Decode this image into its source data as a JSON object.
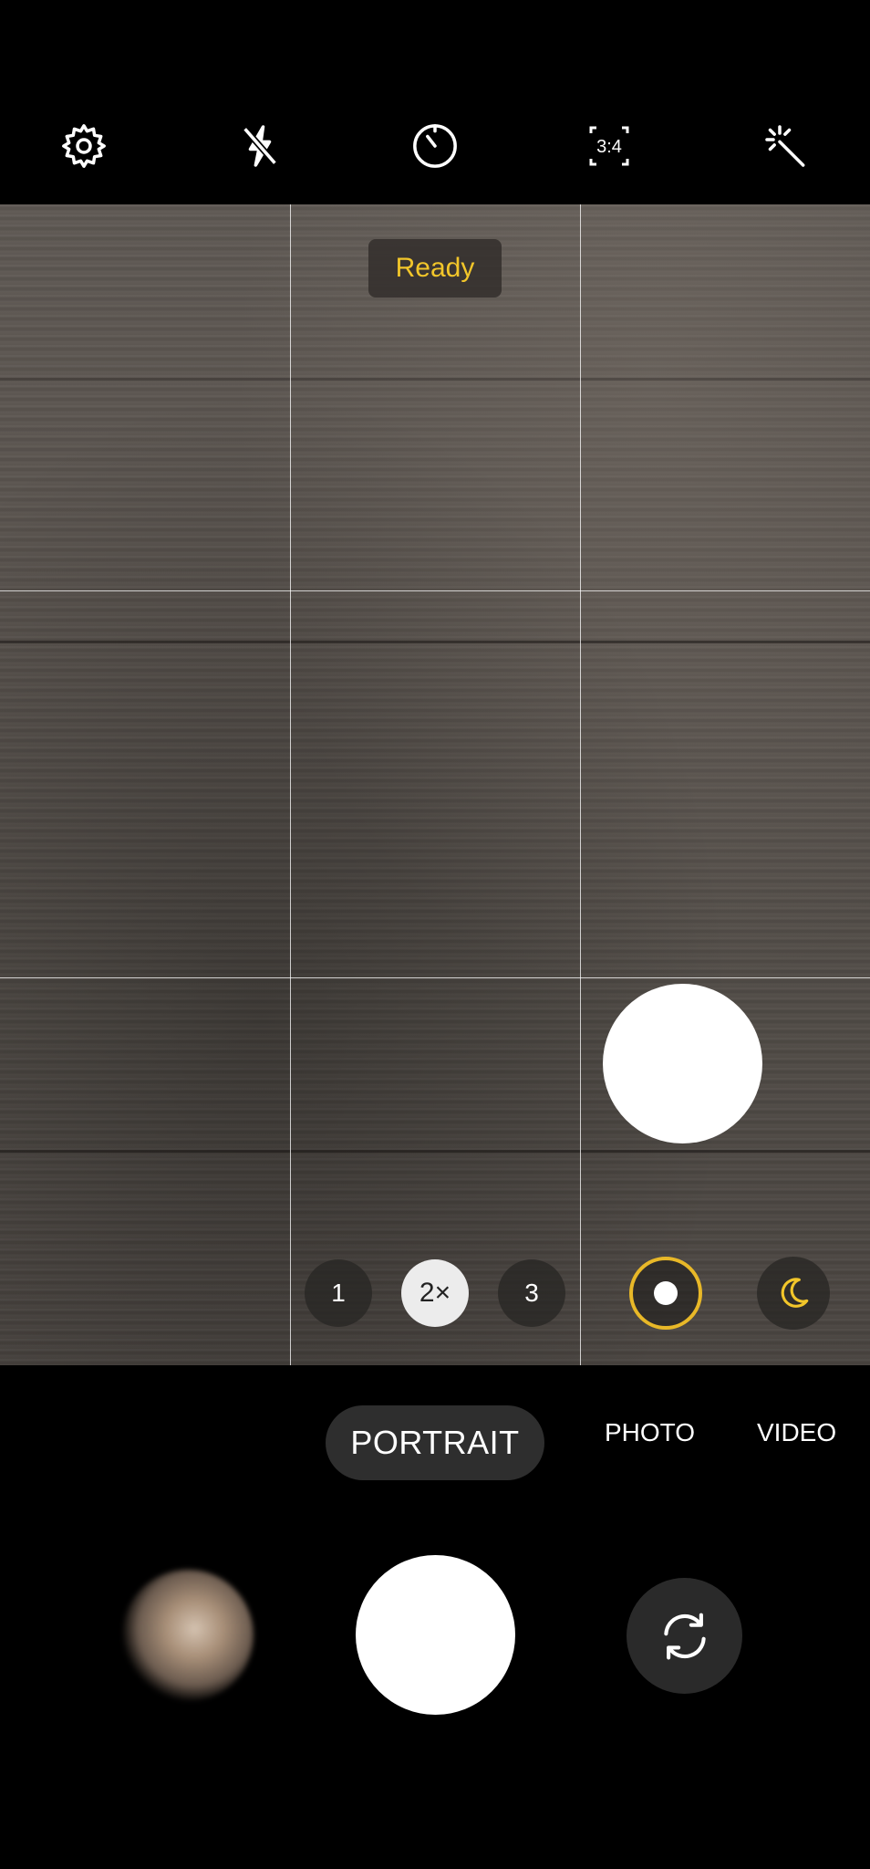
{
  "top_bar": {
    "icons": [
      "settings-icon",
      "flash-off-icon",
      "timer-icon",
      "aspect-ratio-icon",
      "filters-icon"
    ],
    "aspect_ratio_label": "3:4"
  },
  "viewfinder": {
    "status_text": "Ready",
    "zoom_options": [
      {
        "label": "1",
        "selected": false
      },
      {
        "label": "2×",
        "selected": true
      },
      {
        "label": "3",
        "selected": false
      }
    ],
    "colors": {
      "status": "#f2c62a",
      "effect_ring": "#e8b828",
      "night_icon": "#f2c62a"
    }
  },
  "modes": {
    "active": "PORTRAIT",
    "others": [
      "PHOTO",
      "VIDEO"
    ]
  },
  "bottom": {
    "icons": [
      "gallery-thumbnail",
      "shutter-button",
      "switch-camera-icon"
    ]
  }
}
